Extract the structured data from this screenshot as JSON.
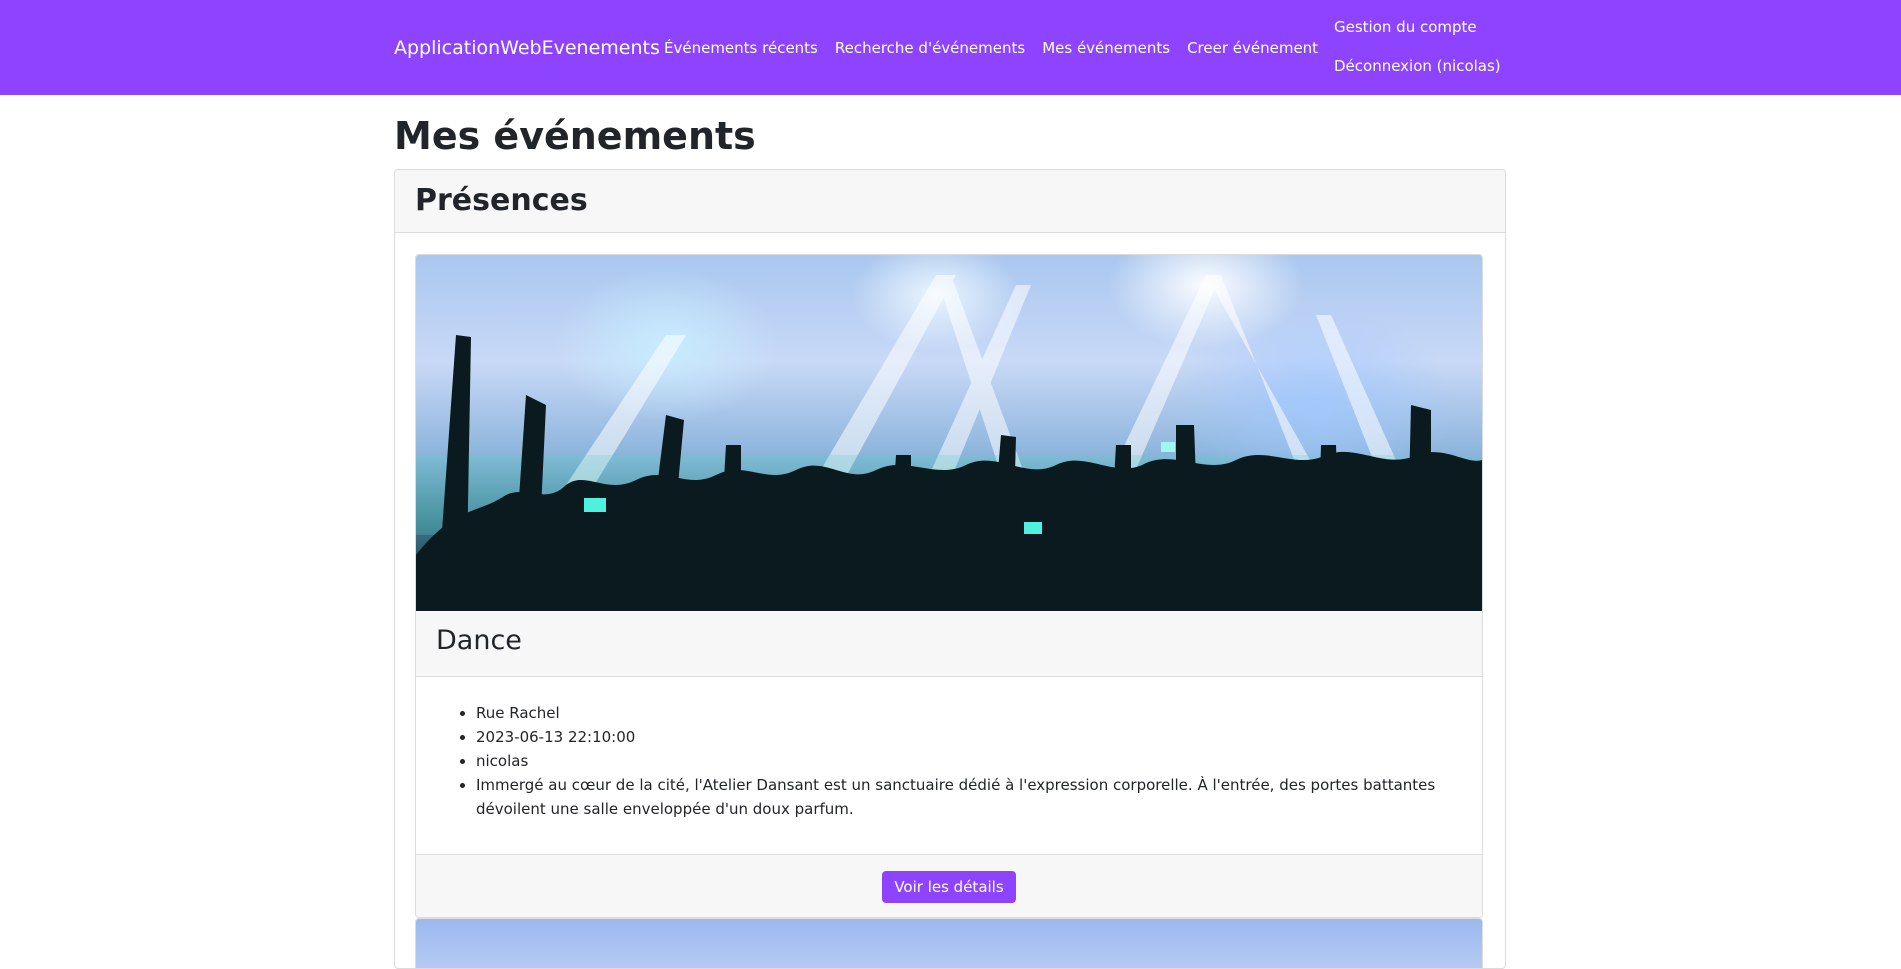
{
  "navbar": {
    "brand": "ApplicationWebEvenements",
    "links": [
      {
        "label": "Événements récents"
      },
      {
        "label": "Recherche d'événements"
      },
      {
        "label": "Mes événements"
      },
      {
        "label": "Creer événement"
      }
    ],
    "right_links": [
      {
        "label": "Gestion du compte"
      },
      {
        "label": "Déconnexion (nicolas)"
      }
    ]
  },
  "page": {
    "title": "Mes événements"
  },
  "section": {
    "title": "Présences"
  },
  "events": [
    {
      "image_icon": "concert-crowd-image",
      "name": "Dance",
      "details": [
        "Rue Rachel",
        "2023-06-13 22:10:00",
        "nicolas",
        "Immergé au cœur de la cité, l'Atelier Dansant est un sanctuaire dédié à l'expression corporelle. À l'entrée, des portes battantes dévoilent une salle enveloppée d'un doux parfum."
      ],
      "button_label": "Voir les détails"
    }
  ],
  "colors": {
    "navbar_bg": "#8e44ff",
    "button_bg": "#8e44ff",
    "card_header_bg": "#f7f7f7"
  }
}
